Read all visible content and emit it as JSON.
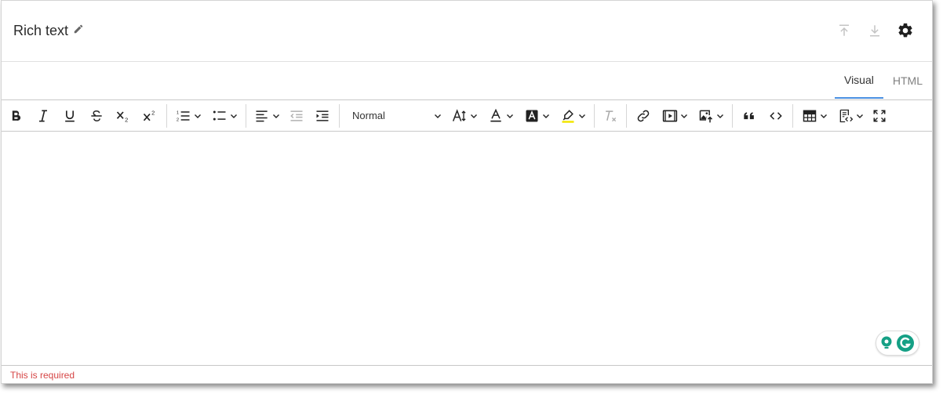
{
  "header": {
    "title": "Rich text"
  },
  "tabs": [
    {
      "label": "Visual",
      "active": true
    },
    {
      "label": "HTML",
      "active": false
    }
  ],
  "toolbar": {
    "block_format": "Normal"
  },
  "error_text": "This is required",
  "colors": {
    "accent": "#4a90e2",
    "error": "#d64545",
    "highlight": "#f2e600",
    "grammarly": "#15a085"
  }
}
